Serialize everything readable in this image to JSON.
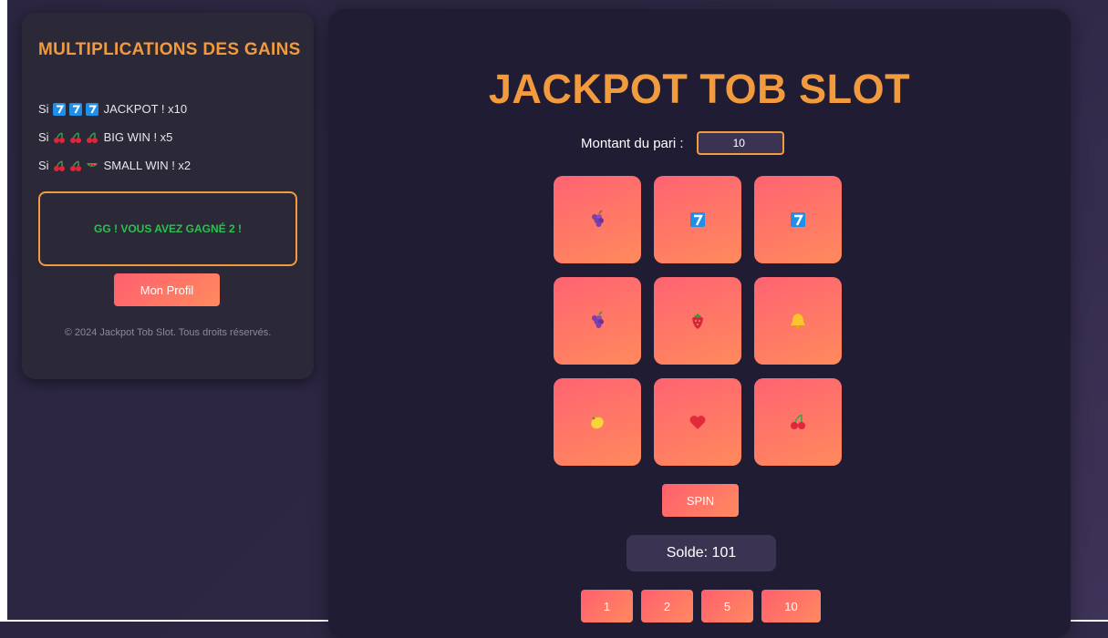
{
  "sidebar": {
    "title": "MULTIPLICATIONS DES GAINS",
    "rules": [
      {
        "prefix": "Si",
        "symbols": [
          "seven-icon",
          "seven-icon",
          "seven-icon"
        ],
        "text": "JACKPOT ! x10"
      },
      {
        "prefix": "Si",
        "symbols": [
          "cherries-icon",
          "cherries-icon",
          "cherries-icon"
        ],
        "text": "BIG WIN ! x5"
      },
      {
        "prefix": "Si",
        "symbols": [
          "cherries-icon",
          "cherries-icon",
          "watermelon-icon"
        ],
        "text": "SMALL WIN ! x2"
      }
    ],
    "result_message": "GG ! VOUS AVEZ GAGNÉ 2 !",
    "profile_button": "Mon Profil",
    "copyright": "© 2024 Jackpot Tob Slot. Tous droits réservés."
  },
  "game": {
    "title": "JACKPOT TOB SLOT",
    "bet_label": "Montant du pari :",
    "bet_value": "10",
    "reels": [
      [
        "grapes-icon",
        "seven-icon",
        "seven-icon"
      ],
      [
        "grapes-icon",
        "strawberry-icon",
        "bell-icon"
      ],
      [
        "lemon-icon",
        "heart-icon",
        "cherries-icon"
      ]
    ],
    "spin_label": "SPIN",
    "balance_label": "Solde: 101",
    "bet_buttons": [
      "1",
      "2",
      "5",
      "10"
    ]
  },
  "colors": {
    "accent": "#f19a3e",
    "success": "#2cc14f",
    "button_gradient_start": "#ff5f6d",
    "button_gradient_end": "#ff8a60",
    "panel": "#2b2838",
    "main_panel": "#201c34"
  }
}
